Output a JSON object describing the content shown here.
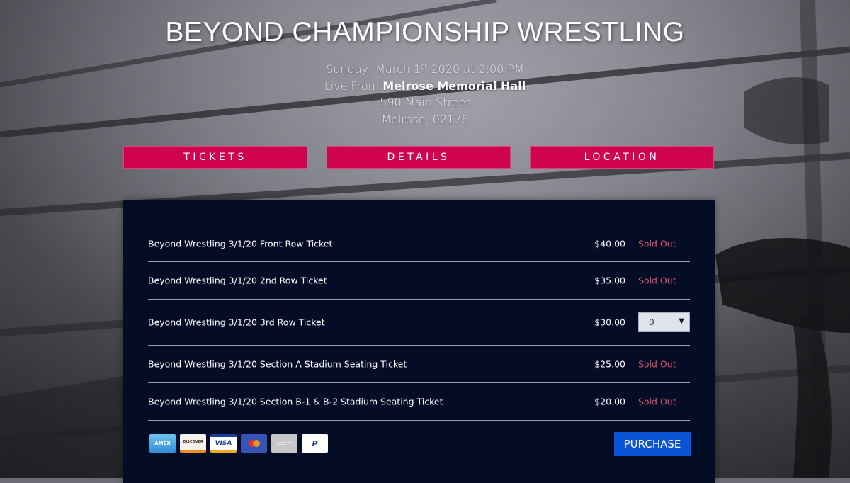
{
  "header": {
    "title": "BEYOND CHAMPIONSHIP WRESTLING",
    "date_prefix": "Sunday, March 1",
    "date_sup": "st",
    "date_suffix": " 2020 at 2:00 PM",
    "venue_prefix": "Live From ",
    "venue_name": "Melrose Memorial Hall",
    "address_line1": "590 Main Street",
    "address_line2": "Melrose, 02176"
  },
  "nav": {
    "tickets_label": "TICKETS",
    "details_label": "DETAILS",
    "location_label": "LOCATION"
  },
  "tickets": [
    {
      "name": "Beyond Wrestling 3/1/20 Front Row Ticket",
      "price": "$40.00",
      "status": "Sold Out"
    },
    {
      "name": "Beyond Wrestling 3/1/20 2nd Row Ticket",
      "price": "$35.00",
      "status": "Sold Out"
    },
    {
      "name": "Beyond Wrestling 3/1/20 3rd Row Ticket",
      "price": "$30.00",
      "quantity": "0"
    },
    {
      "name": "Beyond Wrestling 3/1/20 Section A Stadium Seating Ticket",
      "price": "$25.00",
      "status": "Sold Out"
    },
    {
      "name": "Beyond Wrestling 3/1/20 Section B-1 & B-2 Stadium Seating Ticket",
      "price": "$20.00",
      "status": "Sold Out"
    }
  ],
  "payments": [
    {
      "icon": "amex-card-icon",
      "label": "AMEX"
    },
    {
      "icon": "discover-card-icon",
      "label": "DISCOVER"
    },
    {
      "icon": "visa-card-icon",
      "label": "VISA"
    },
    {
      "icon": "mastercard-icon",
      "label": ""
    },
    {
      "icon": "generic-card-icon",
      "label": ""
    },
    {
      "icon": "paypal-icon",
      "label": "P"
    }
  ],
  "purchase_label": "PURCHASE",
  "colors": {
    "nav_accent": "#d0034f",
    "panel_bg": "#050d26",
    "sold_out": "#d95468",
    "purchase_button": "#0a54d6"
  }
}
